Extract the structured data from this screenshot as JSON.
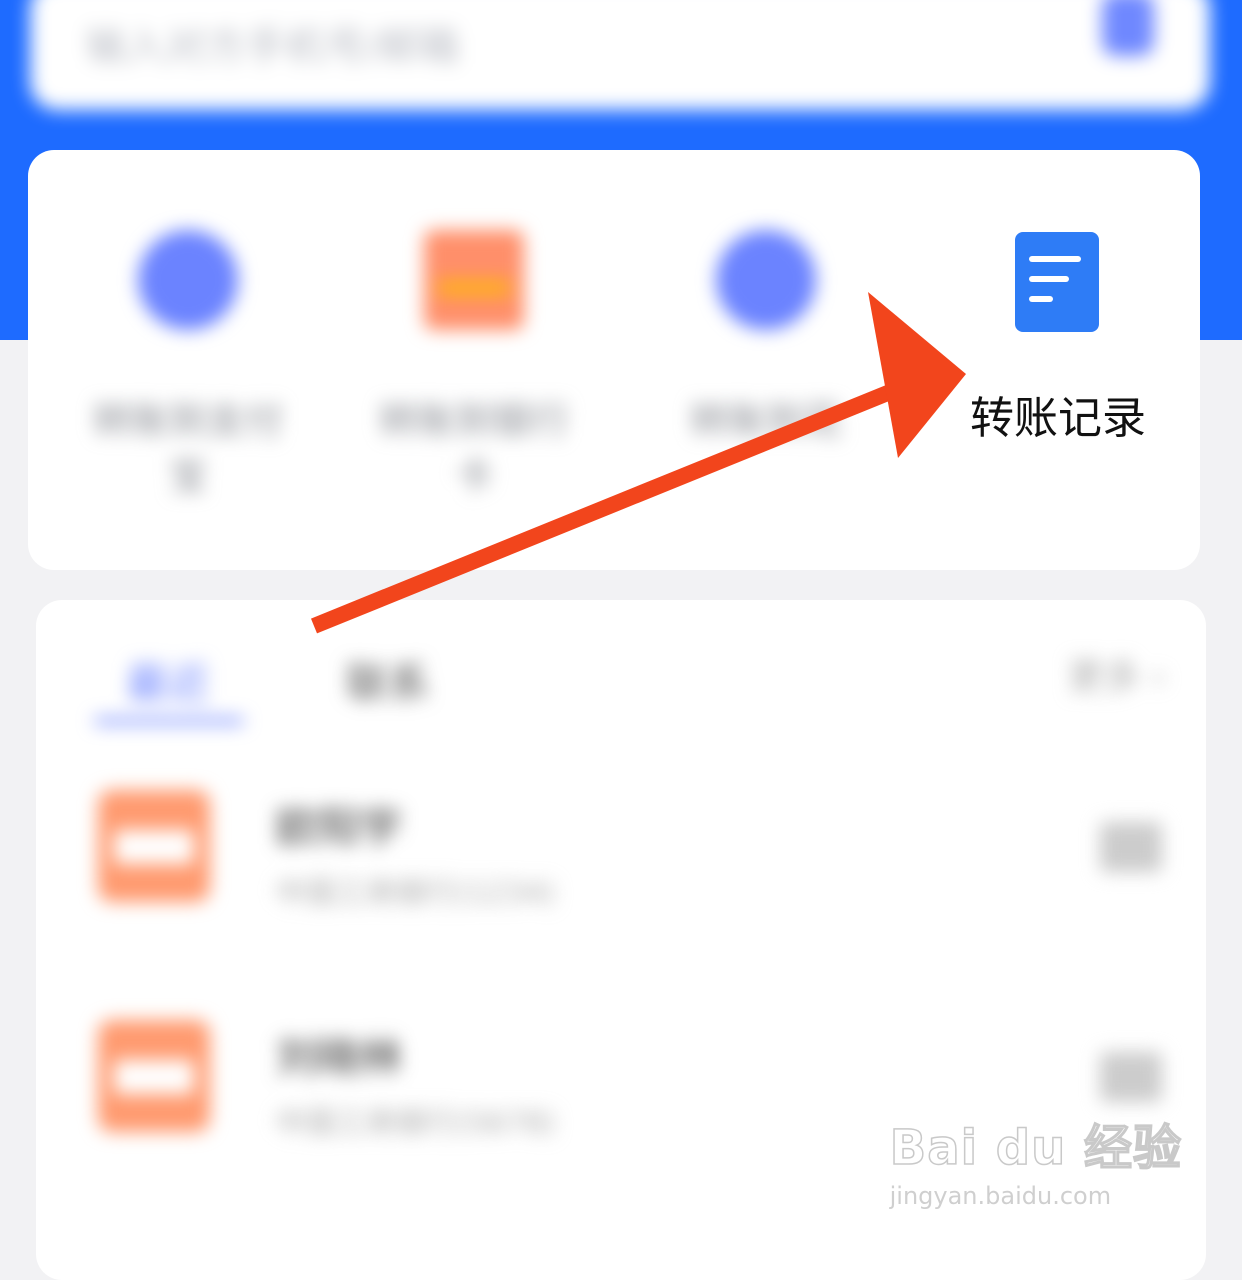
{
  "search": {
    "placeholder": "输入对方手机号/邮箱"
  },
  "functions": {
    "items": [
      {
        "label": "转账到支付宝"
      },
      {
        "label": "转账到银行卡"
      },
      {
        "label": "转账到花"
      }
    ],
    "records_label": "转账记录"
  },
  "list": {
    "tabs": [
      {
        "label": "最近"
      },
      {
        "label": "联系"
      }
    ],
    "more_label": "更多 ›",
    "contacts": [
      {
        "name": "欧阳宇",
        "detail": "中国工商银行(1234)"
      },
      {
        "name": "刘晓林",
        "detail": "中国工商银行(5678)"
      }
    ]
  },
  "watermark": {
    "logo": "Bai du 经验",
    "site": "jingyan.baidu.com"
  },
  "colors": {
    "header_blue": "#1e6bff",
    "arrow": "#f2451c",
    "doc_icon": "#2e7cf6"
  }
}
